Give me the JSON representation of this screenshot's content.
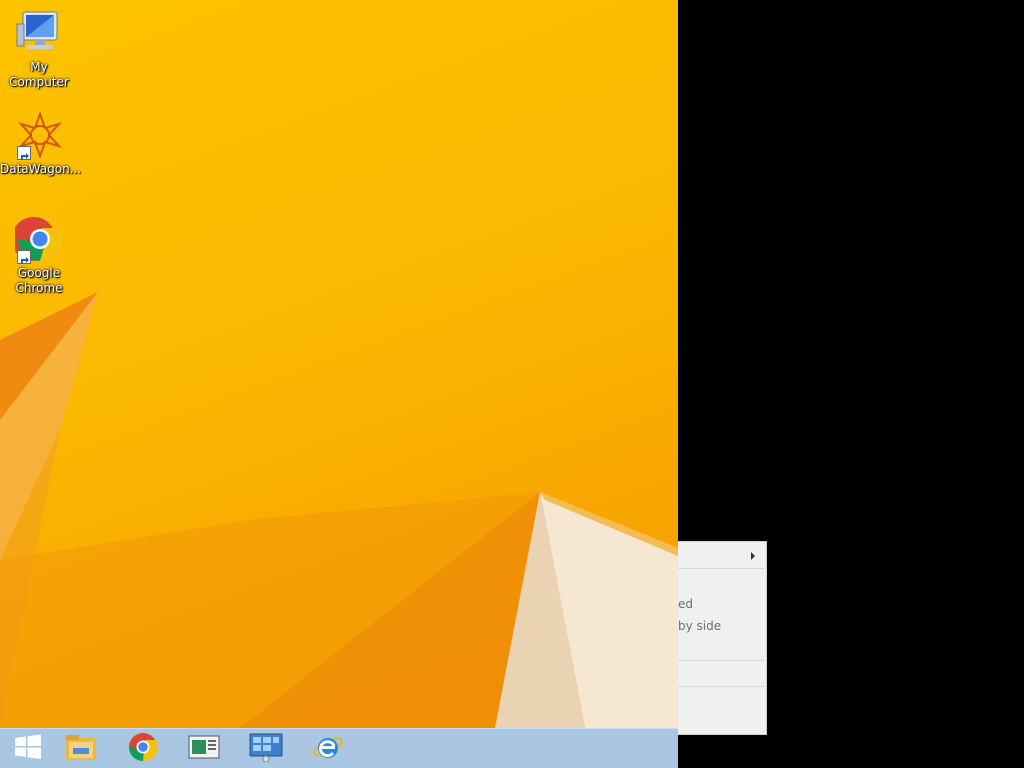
{
  "desktop": {
    "icons": [
      {
        "id": "my-computer",
        "label": "My Computer"
      },
      {
        "id": "datawagon",
        "label": "DataWagon..."
      },
      {
        "id": "google-chrome",
        "label": "Google\nChrome"
      }
    ]
  },
  "taskbar": {
    "buttons": [
      "windows-start-icon",
      "file-explorer-icon",
      "chrome-icon",
      "server-manager-icon",
      "control-panel-icon",
      "internet-explorer-icon"
    ]
  },
  "context_menu": {
    "items": [
      {
        "label": ""
      },
      {
        "label": "ed"
      },
      {
        "label": "by side"
      },
      {
        "label": ""
      },
      {
        "label": ""
      }
    ]
  },
  "colors": {
    "taskbar": "#a9c6e2",
    "wallpaper": "#fbb800",
    "menu_bg": "#f0f0f0"
  }
}
